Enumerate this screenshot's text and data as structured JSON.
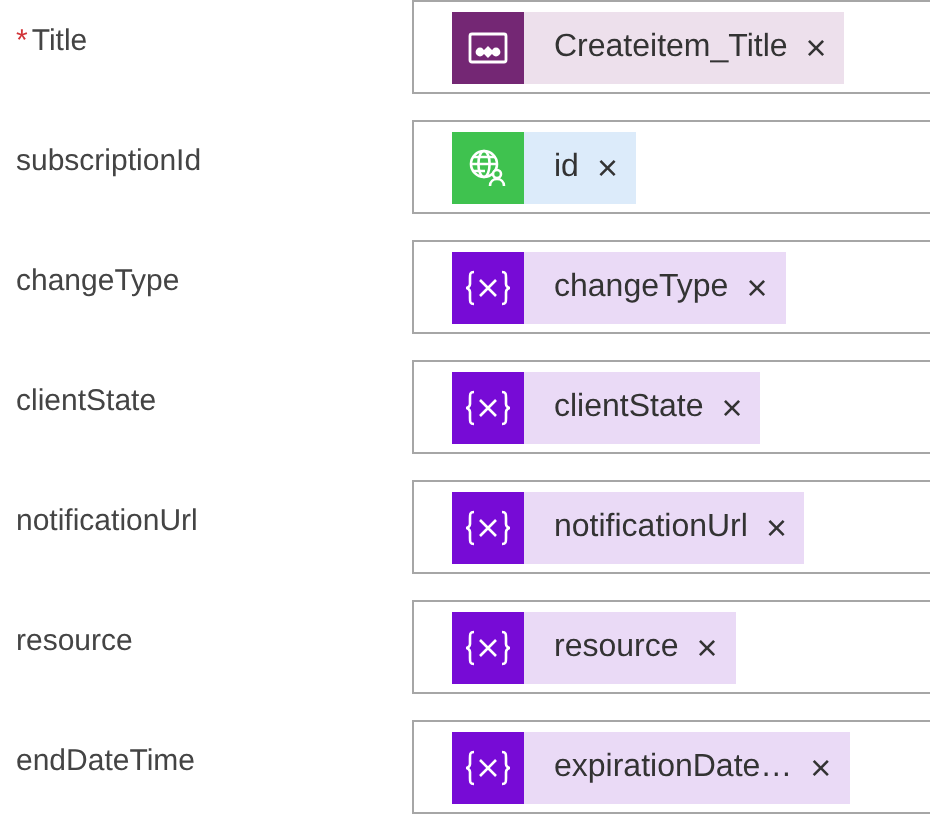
{
  "fields": [
    {
      "label": "Title",
      "required": true,
      "token": {
        "kind": "app",
        "text": "Createitem_Title"
      }
    },
    {
      "label": "subscriptionId",
      "required": false,
      "token": {
        "kind": "web",
        "text": "id"
      }
    },
    {
      "label": "changeType",
      "required": false,
      "token": {
        "kind": "variable",
        "text": "changeType"
      }
    },
    {
      "label": "clientState",
      "required": false,
      "token": {
        "kind": "variable",
        "text": "clientState"
      }
    },
    {
      "label": "notificationUrl",
      "required": false,
      "token": {
        "kind": "variable",
        "text": "notificationUrl"
      }
    },
    {
      "label": "resource",
      "required": false,
      "token": {
        "kind": "variable",
        "text": "resource"
      }
    },
    {
      "label": "endDateTime",
      "required": false,
      "token": {
        "kind": "variable",
        "text": "expirationDate…"
      }
    }
  ],
  "remove_symbol": "×",
  "required_symbol": "*"
}
